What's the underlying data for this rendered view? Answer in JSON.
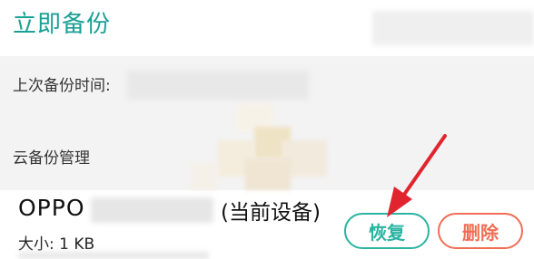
{
  "header": {
    "title": "立即备份"
  },
  "backup_info": {
    "last_backup_label": "上次备份时间:"
  },
  "cloud": {
    "section_title": "云备份管理"
  },
  "device": {
    "name": "OPPO",
    "current_label": "(当前设备)",
    "size_label": "大小: 1 KB"
  },
  "actions": {
    "restore_label": "恢复",
    "delete_label": "删除"
  },
  "colors": {
    "accent": "#1aa094",
    "restore": "#2bb3a1",
    "delete": "#f06d54",
    "arrow": "#e0252f"
  },
  "icons": {
    "annotation": "arrow-pointer-icon"
  }
}
